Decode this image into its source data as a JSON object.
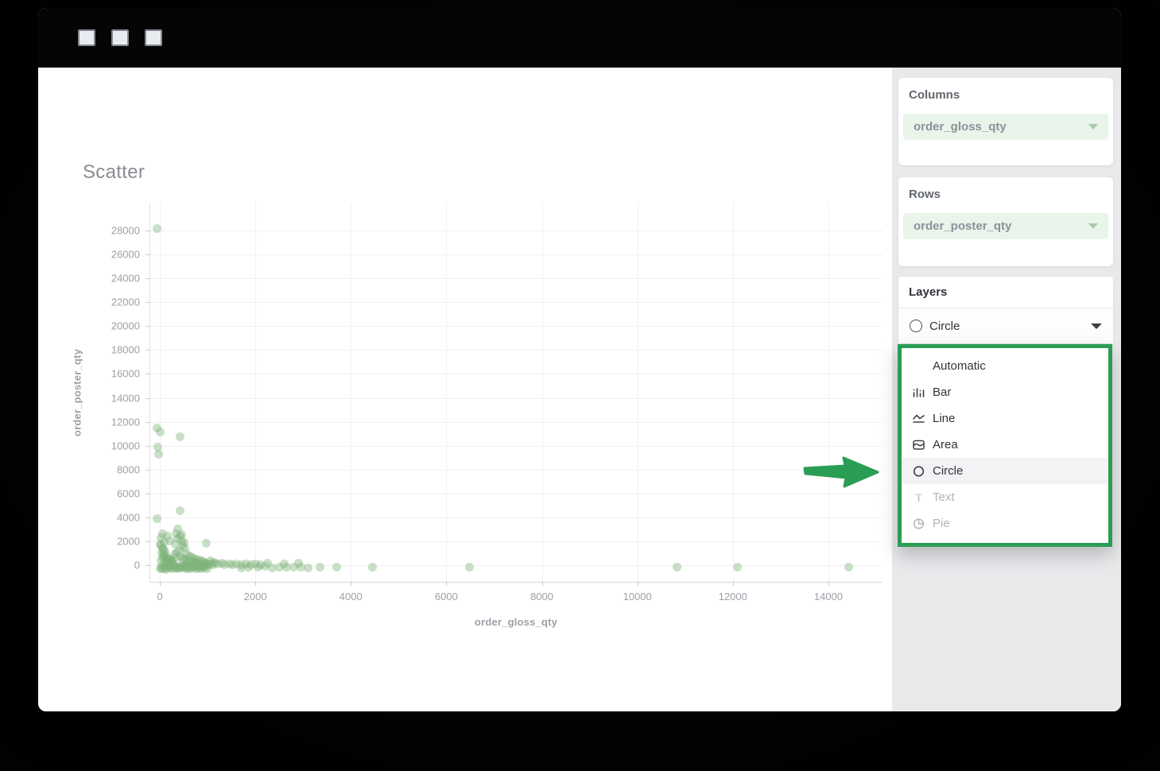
{
  "chart": {
    "title": "Scatter"
  },
  "chart_data": {
    "type": "scatter",
    "title": "Scatter",
    "xlabel": "order_gloss_qty",
    "ylabel": "order_poster_qty",
    "x_ticks": [
      0,
      2000,
      4000,
      6000,
      8000,
      10000,
      12000,
      14000
    ],
    "y_ticks": [
      0,
      2000,
      4000,
      6000,
      8000,
      10000,
      12000,
      14000,
      16000,
      18000,
      20000,
      22000,
      24000,
      26000,
      28000
    ],
    "xlim": [
      -200,
      15150
    ],
    "ylim": [
      -1460,
      30330
    ],
    "grid": true,
    "point_color": "rgba(127,178,122,0.42)",
    "points": [
      [
        -60,
        28150
      ],
      [
        -60,
        11500
      ],
      [
        10,
        11120
      ],
      [
        430,
        10750
      ],
      [
        -40,
        9850
      ],
      [
        -30,
        9300
      ],
      [
        420,
        4550
      ],
      [
        -60,
        3900
      ],
      [
        380,
        3000
      ],
      [
        60,
        2650
      ],
      [
        460,
        2550
      ],
      [
        160,
        2450
      ],
      [
        30,
        2300
      ],
      [
        980,
        1850
      ],
      [
        200,
        2050
      ],
      [
        90,
        1900
      ],
      [
        10,
        1750
      ],
      [
        340,
        2600
      ],
      [
        420,
        2450
      ],
      [
        380,
        2200
      ],
      [
        450,
        2050
      ],
      [
        500,
        1900
      ],
      [
        330,
        1750
      ],
      [
        470,
        1600
      ],
      [
        520,
        1400
      ],
      [
        400,
        1250
      ],
      [
        360,
        1100
      ],
      [
        550,
        950
      ],
      [
        600,
        800
      ],
      [
        430,
        700
      ],
      [
        480,
        600
      ],
      [
        510,
        500
      ],
      [
        560,
        420
      ],
      [
        620,
        330
      ],
      [
        580,
        240
      ],
      [
        640,
        150
      ],
      [
        300,
        900
      ],
      [
        320,
        650
      ],
      [
        20,
        1600
      ],
      [
        50,
        1450
      ],
      [
        80,
        1300
      ],
      [
        110,
        1150
      ],
      [
        40,
        1050
      ],
      [
        70,
        950
      ],
      [
        130,
        850
      ],
      [
        90,
        750
      ],
      [
        60,
        640
      ],
      [
        140,
        560
      ],
      [
        170,
        480
      ],
      [
        100,
        420
      ],
      [
        30,
        350
      ],
      [
        120,
        300
      ],
      [
        190,
        240
      ],
      [
        150,
        180
      ],
      [
        210,
        520
      ],
      [
        240,
        430
      ],
      [
        260,
        340
      ],
      [
        230,
        260
      ],
      [
        250,
        160
      ],
      [
        280,
        90
      ],
      [
        650,
        700
      ],
      [
        700,
        600
      ],
      [
        760,
        500
      ],
      [
        820,
        420
      ],
      [
        880,
        350
      ],
      [
        900,
        270
      ],
      [
        950,
        200
      ],
      [
        980,
        140
      ],
      [
        700,
        300
      ],
      [
        750,
        240
      ],
      [
        800,
        180
      ],
      [
        850,
        110
      ],
      [
        920,
        80
      ],
      [
        1000,
        50
      ],
      [
        1060,
        350
      ],
      [
        1120,
        250
      ],
      [
        1050,
        120
      ],
      [
        1100,
        60
      ],
      [
        1150,
        200
      ],
      [
        1220,
        90
      ],
      [
        1300,
        140
      ],
      [
        1360,
        40
      ],
      [
        1450,
        90
      ],
      [
        1520,
        30
      ],
      [
        1600,
        110
      ],
      [
        1700,
        50
      ],
      [
        1800,
        120
      ],
      [
        1900,
        30
      ],
      [
        2000,
        80
      ],
      [
        2100,
        40
      ],
      [
        0,
        -300
      ],
      [
        25,
        -150
      ],
      [
        50,
        -280
      ],
      [
        75,
        -60
      ],
      [
        100,
        -220
      ],
      [
        125,
        -330
      ],
      [
        150,
        -100
      ],
      [
        175,
        -250
      ],
      [
        200,
        -40
      ],
      [
        225,
        -180
      ],
      [
        250,
        -300
      ],
      [
        275,
        -120
      ],
      [
        300,
        -240
      ],
      [
        325,
        -30
      ],
      [
        350,
        -200
      ],
      [
        375,
        -320
      ],
      [
        400,
        -90
      ],
      [
        425,
        -260
      ],
      [
        450,
        -150
      ],
      [
        475,
        -20
      ],
      [
        500,
        -230
      ],
      [
        525,
        -110
      ],
      [
        550,
        -290
      ],
      [
        575,
        -50
      ],
      [
        600,
        -190
      ],
      [
        625,
        -310
      ],
      [
        650,
        -80
      ],
      [
        675,
        -240
      ],
      [
        700,
        -140
      ],
      [
        725,
        -20
      ],
      [
        750,
        -270
      ],
      [
        775,
        -100
      ],
      [
        800,
        -210
      ],
      [
        825,
        -40
      ],
      [
        850,
        -300
      ],
      [
        875,
        -160
      ],
      [
        900,
        -70
      ],
      [
        930,
        -230
      ],
      [
        960,
        -120
      ],
      [
        990,
        -280
      ],
      [
        2250,
        180
      ],
      [
        2600,
        120
      ],
      [
        2900,
        160
      ],
      [
        1700,
        -200
      ],
      [
        1850,
        -150
      ],
      [
        2050,
        -180
      ],
      [
        2200,
        -120
      ],
      [
        2350,
        -200
      ],
      [
        2500,
        -150
      ],
      [
        2650,
        -190
      ],
      [
        2800,
        -130
      ],
      [
        2950,
        -170
      ],
      [
        3100,
        -200
      ],
      [
        3350,
        -160
      ],
      [
        3700,
        -180
      ],
      [
        4450,
        -160
      ],
      [
        6480,
        -170
      ],
      [
        10830,
        -150
      ],
      [
        12100,
        -180
      ],
      [
        14430,
        -170
      ]
    ]
  },
  "sidebar": {
    "columns": {
      "header": "Columns",
      "value": "order_gloss_qty"
    },
    "rows": {
      "header": "Rows",
      "value": "order_poster_qty"
    },
    "layers": {
      "header": "Layers",
      "selected_value": "Circle",
      "menu": [
        {
          "label": "Automatic",
          "icon": "none",
          "selected": false,
          "disabled": false
        },
        {
          "label": "Bar",
          "icon": "bar-chart-icon",
          "selected": false,
          "disabled": false
        },
        {
          "label": "Line",
          "icon": "line-chart-icon",
          "selected": false,
          "disabled": false
        },
        {
          "label": "Area",
          "icon": "area-chart-icon",
          "selected": false,
          "disabled": false
        },
        {
          "label": "Circle",
          "icon": "circle-icon",
          "selected": true,
          "disabled": false
        },
        {
          "label": "Text",
          "icon": "text-icon",
          "selected": false,
          "disabled": true
        },
        {
          "label": "Pie",
          "icon": "pie-icon",
          "selected": false,
          "disabled": true
        }
      ]
    }
  },
  "colors": {
    "accent_green": "#2a9d54",
    "pill_background": "#e9f4ea",
    "sidebar_background": "#e9e9ec",
    "point_green": "#7fb27a"
  }
}
